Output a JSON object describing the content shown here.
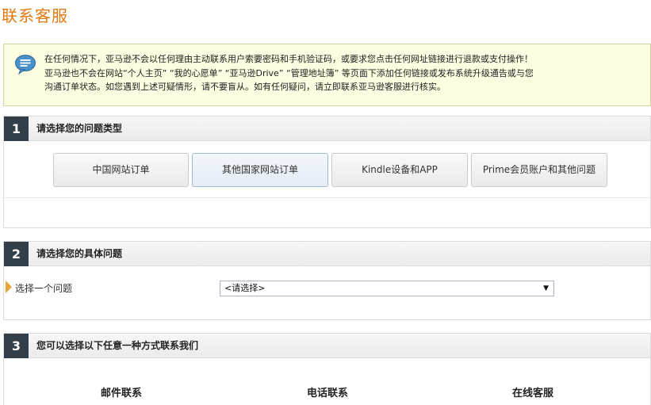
{
  "page": {
    "title": "联系客服"
  },
  "notice": {
    "line1": "在任何情况下，亚马逊不会以任何理由主动联系用户索要密码和手机验证码，或要求您点击任何网址链接进行退款或支付操作！",
    "line2": "亚马逊也不会在网站“个人主页” “我的心愿单” “亚马逊Drive” “管理地址簿” 等页面下添加任何链接或发布系统升级通告或与您",
    "line3": "沟通订单状态。如您遇到上述可疑情形，请不要盲从。如有任何疑问，请立即联系亚马逊客服进行核实。"
  },
  "step1": {
    "num": "1",
    "title": "请选择您的问题类型",
    "options": [
      {
        "label": "中国网站订单",
        "selected": false
      },
      {
        "label": "其他国家网站订单",
        "selected": true
      },
      {
        "label": "Kindle设备和APP",
        "selected": false
      },
      {
        "label": "Prime会员账户和其他问题",
        "selected": false
      }
    ]
  },
  "step2": {
    "num": "2",
    "title": "请选择您的具体问题",
    "question_label": "选择一个问题",
    "select_value": "<请选择>"
  },
  "step3": {
    "num": "3",
    "title": "您可以选择以下任意一种方式联系我们",
    "methods": [
      "邮件联系",
      "电话联系",
      "在线客服"
    ]
  }
}
